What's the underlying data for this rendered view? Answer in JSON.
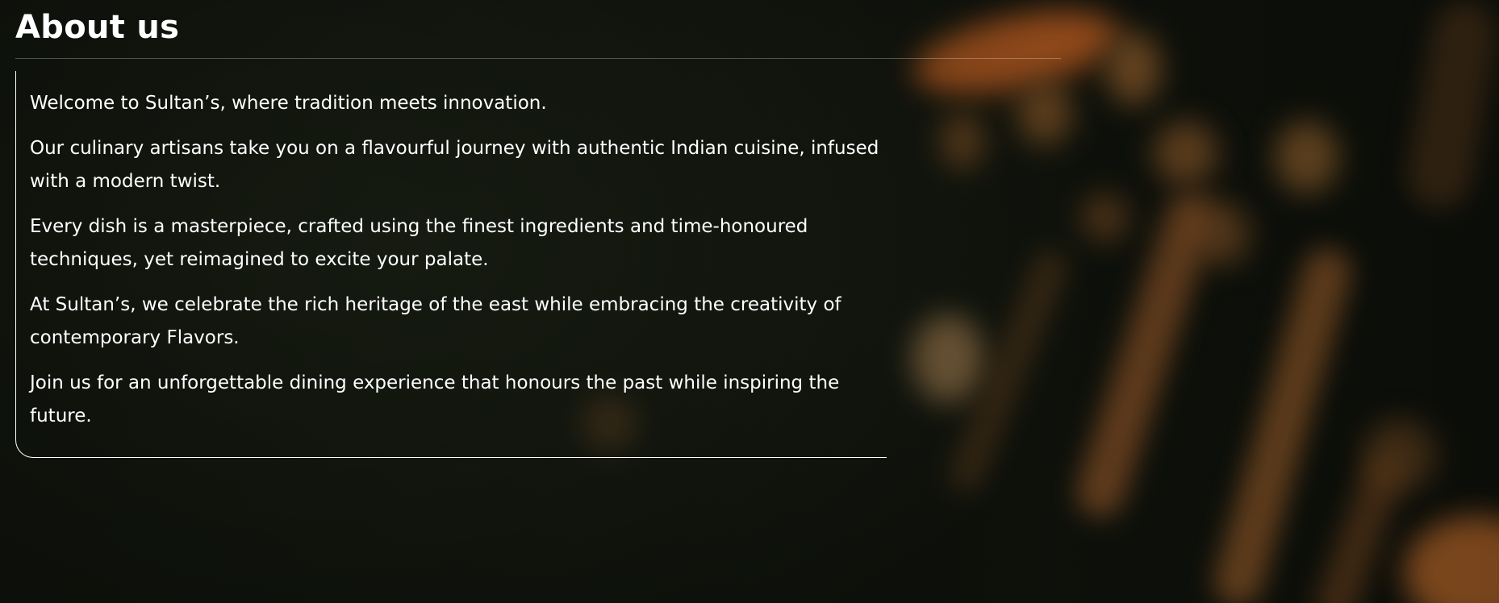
{
  "about": {
    "title": "About us",
    "paragraphs": [
      "Welcome to Sultan’s, where tradition meets innovation.",
      "Our culinary artisans take you on a flavourful journey with authentic Indian cuisine, infused with a modern twist.",
      "Every dish is a masterpiece, crafted using the finest ingredients and time-honoured techniques, yet reimagined to excite your palate.",
      "At Sultan’s, we celebrate the rich heritage of the east while embracing the creativity of contemporary Flavors.",
      "Join us for an unforgettable dining experience that honours the past while inspiring the future."
    ]
  },
  "colors": {
    "text": "#ffffff",
    "background": "#171c12",
    "accent_blur": "#c8742e"
  }
}
